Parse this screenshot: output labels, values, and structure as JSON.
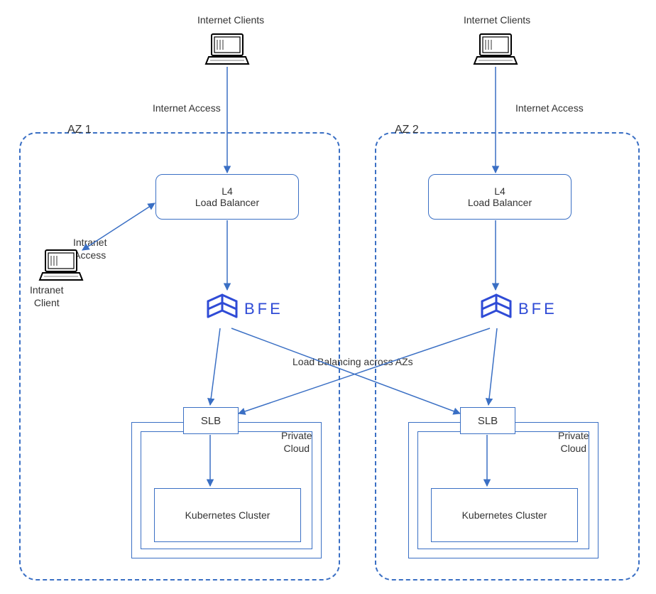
{
  "diagram": {
    "clients": {
      "internet_a": "Internet Clients",
      "internet_b": "Internet Clients",
      "intranet_label": "Intranet\nAccess",
      "intranet_client_label": "Intranet\nClient"
    },
    "edges": {
      "internet_access_a": "Internet Access",
      "internet_access_b": "Internet Access",
      "load_balancing": "Load Balancing across AZs"
    },
    "az1": {
      "title": "AZ 1",
      "l4_title1": "L4",
      "l4_title2": "Load Balancer",
      "bfe": "BFE",
      "slb": "SLB",
      "private_cloud": "Private\nCloud",
      "kube": "Kubernetes\nCluster"
    },
    "az2": {
      "title": "AZ 2",
      "l4_title1": "L4",
      "l4_title2": "Load Balancer",
      "bfe": "BFE",
      "slb": "SLB",
      "private_cloud": "Private\nCloud",
      "kube": "Kubernetes\nCluster"
    }
  }
}
